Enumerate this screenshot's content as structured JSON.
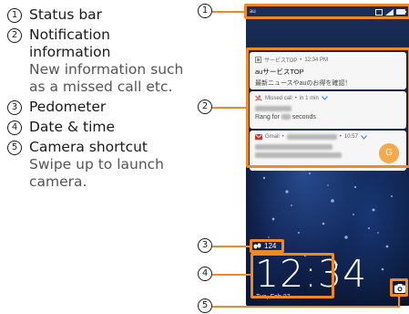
{
  "legend": [
    {
      "num": "1",
      "title": "Status bar",
      "desc": ""
    },
    {
      "num": "2",
      "title": "Notification information",
      "desc": "New information such as a missed call etc."
    },
    {
      "num": "3",
      "title": "Pedometer",
      "desc": ""
    },
    {
      "num": "4",
      "title": "Date & time",
      "desc": ""
    },
    {
      "num": "5",
      "title": "Camera shortcut",
      "desc": "Swipe up to launch camera."
    }
  ],
  "phone": {
    "status_bar": {
      "carrier": "au"
    },
    "notifications": [
      {
        "app": "サービスTOP",
        "time": "12:34 PM",
        "title": "auサービスTOP",
        "text": "最新ニュースやauのお得を確認！"
      },
      {
        "app": "Missed call",
        "time": "in 1 min",
        "text_prefix": "Rang for",
        "text_suffix": "seconds"
      },
      {
        "app": "Gmail",
        "time": "10:57",
        "avatar": "G"
      }
    ],
    "pedometer": {
      "steps": "124"
    },
    "clock": {
      "time": "12:34",
      "date": "Tue, Feb 27"
    }
  },
  "callouts": [
    "1",
    "2",
    "3",
    "4",
    "5"
  ],
  "colors": {
    "highlight": "#f08a20",
    "missed_call": "#e8413a",
    "gmail": "#d93025",
    "avatar": "#f6a94a"
  }
}
